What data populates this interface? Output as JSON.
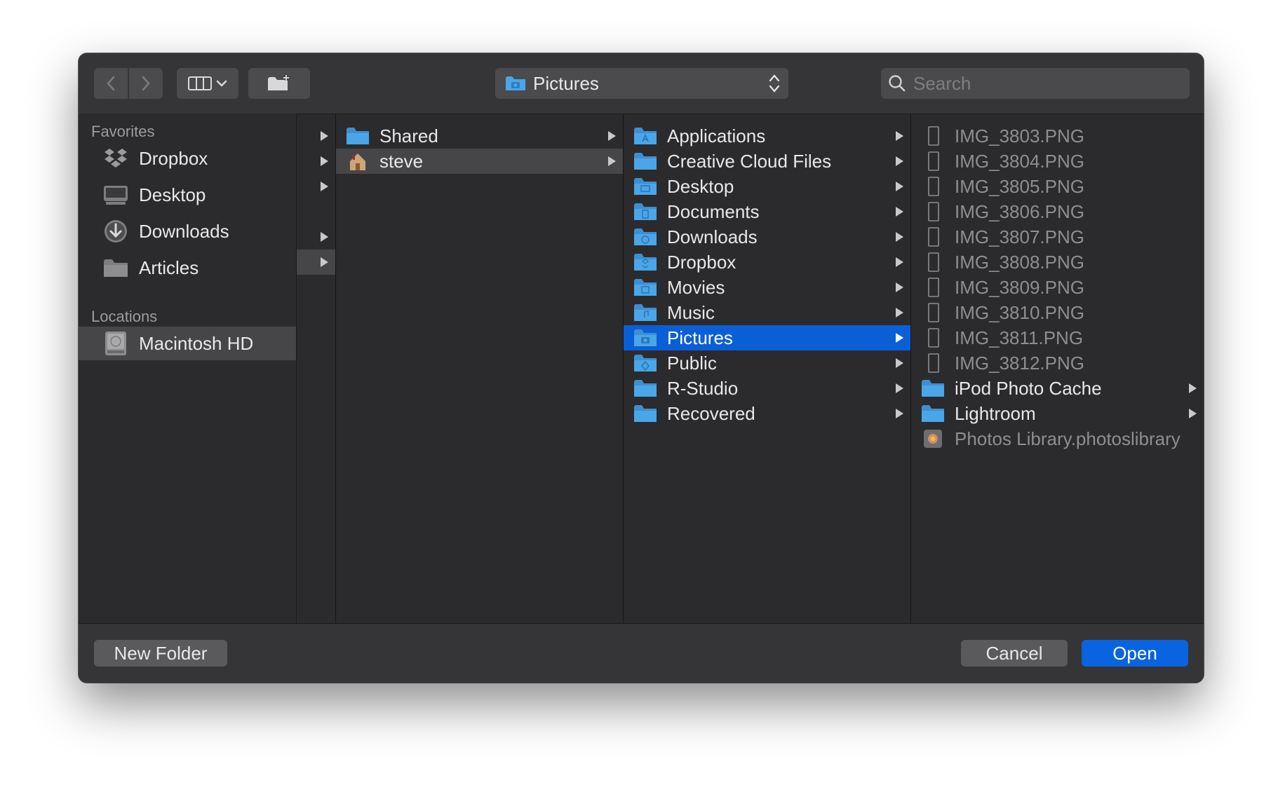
{
  "toolbar": {
    "path_label": "Pictures",
    "search_placeholder": "Search"
  },
  "sidebar": {
    "favorites_heading": "Favorites",
    "favorites": [
      {
        "label": "Dropbox",
        "icon": "dropbox-icon"
      },
      {
        "label": "Desktop",
        "icon": "desktop-icon"
      },
      {
        "label": "Downloads",
        "icon": "downloads-icon"
      },
      {
        "label": "Articles",
        "icon": "folder-icon"
      }
    ],
    "locations_heading": "Locations",
    "locations": [
      {
        "label": "Macintosh HD",
        "icon": "hard-drive-icon",
        "selected": true
      }
    ]
  },
  "columns": {
    "users": [
      {
        "label": "Shared",
        "icon": "folder-icon"
      },
      {
        "label": "steve",
        "icon": "home-icon",
        "selected": true
      }
    ],
    "home": [
      {
        "label": "Applications"
      },
      {
        "label": "Creative Cloud Files"
      },
      {
        "label": "Desktop"
      },
      {
        "label": "Documents"
      },
      {
        "label": "Downloads"
      },
      {
        "label": "Dropbox"
      },
      {
        "label": "Movies"
      },
      {
        "label": "Music"
      },
      {
        "label": "Pictures",
        "selected": true
      },
      {
        "label": "Public"
      },
      {
        "label": "R-Studio"
      },
      {
        "label": "Recovered"
      }
    ],
    "pictures": [
      {
        "label": "IMG_3803.PNG",
        "kind": "file"
      },
      {
        "label": "IMG_3804.PNG",
        "kind": "file"
      },
      {
        "label": "IMG_3805.PNG",
        "kind": "file"
      },
      {
        "label": "IMG_3806.PNG",
        "kind": "file"
      },
      {
        "label": "IMG_3807.PNG",
        "kind": "file"
      },
      {
        "label": "IMG_3808.PNG",
        "kind": "file"
      },
      {
        "label": "IMG_3809.PNG",
        "kind": "file"
      },
      {
        "label": "IMG_3810.PNG",
        "kind": "file"
      },
      {
        "label": "IMG_3811.PNG",
        "kind": "file"
      },
      {
        "label": "IMG_3812.PNG",
        "kind": "file"
      },
      {
        "label": "iPod Photo Cache",
        "kind": "folder"
      },
      {
        "label": "Lightroom",
        "kind": "folder"
      },
      {
        "label": "Photos Library.photoslibrary",
        "kind": "library"
      }
    ]
  },
  "buttons": {
    "new_folder": "New Folder",
    "cancel": "Cancel",
    "open": "Open"
  },
  "colors": {
    "accent": "#0a63e0",
    "selection": "#0a5fd6",
    "folder": "#4aa6e8"
  }
}
